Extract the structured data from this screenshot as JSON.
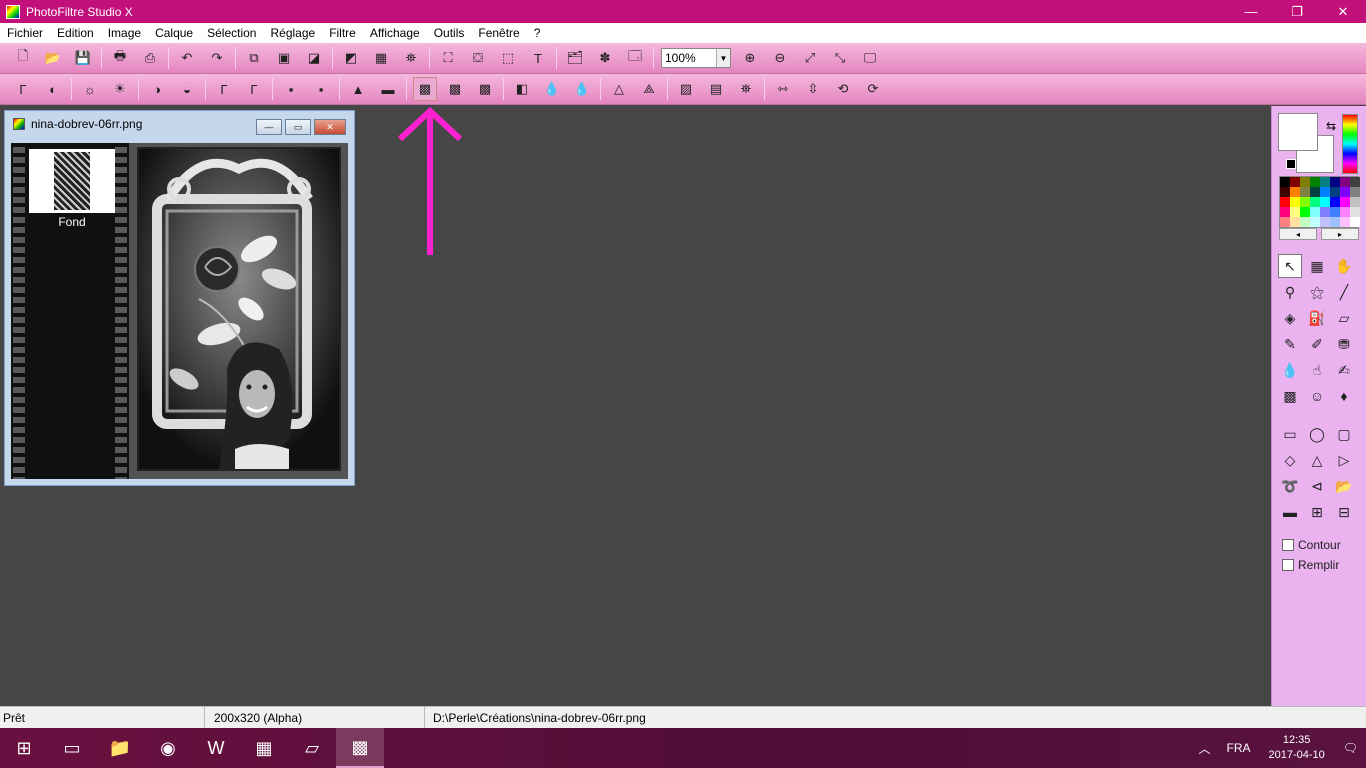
{
  "window": {
    "title": "PhotoFiltre Studio X",
    "minimize": "—",
    "maximize": "❐",
    "close": "✕"
  },
  "menu": [
    "Fichier",
    "Edition",
    "Image",
    "Calque",
    "Sélection",
    "Réglage",
    "Filtre",
    "Affichage",
    "Outils",
    "Fenêtre",
    "?"
  ],
  "toolbar": {
    "zoom_value": "100%",
    "dropdown": "▼"
  },
  "document": {
    "title": "nina-dobrev-06rr.png",
    "layer_name": "Fond",
    "btn_min": "—",
    "btn_max": "▭",
    "btn_close": "✕"
  },
  "panel": {
    "checkbox_contour": "Contour",
    "checkbox_remplir": "Remplir",
    "swap": "⇆",
    "nav_prev": "◂",
    "nav_next": "▸"
  },
  "status": {
    "state": "Prêt",
    "dimensions": "200x320 (Alpha)",
    "path": "D:\\Perle\\Créations\\nina-dobrev-06rr.png"
  },
  "taskbar": {
    "language": "FRA",
    "time": "12:35",
    "date": "2017-04-10"
  },
  "colors": {
    "accent": "#c2107a",
    "toolbar": "#e585c0",
    "panel": "#eab2ef",
    "annotation_arrow": "#ff20d0"
  }
}
